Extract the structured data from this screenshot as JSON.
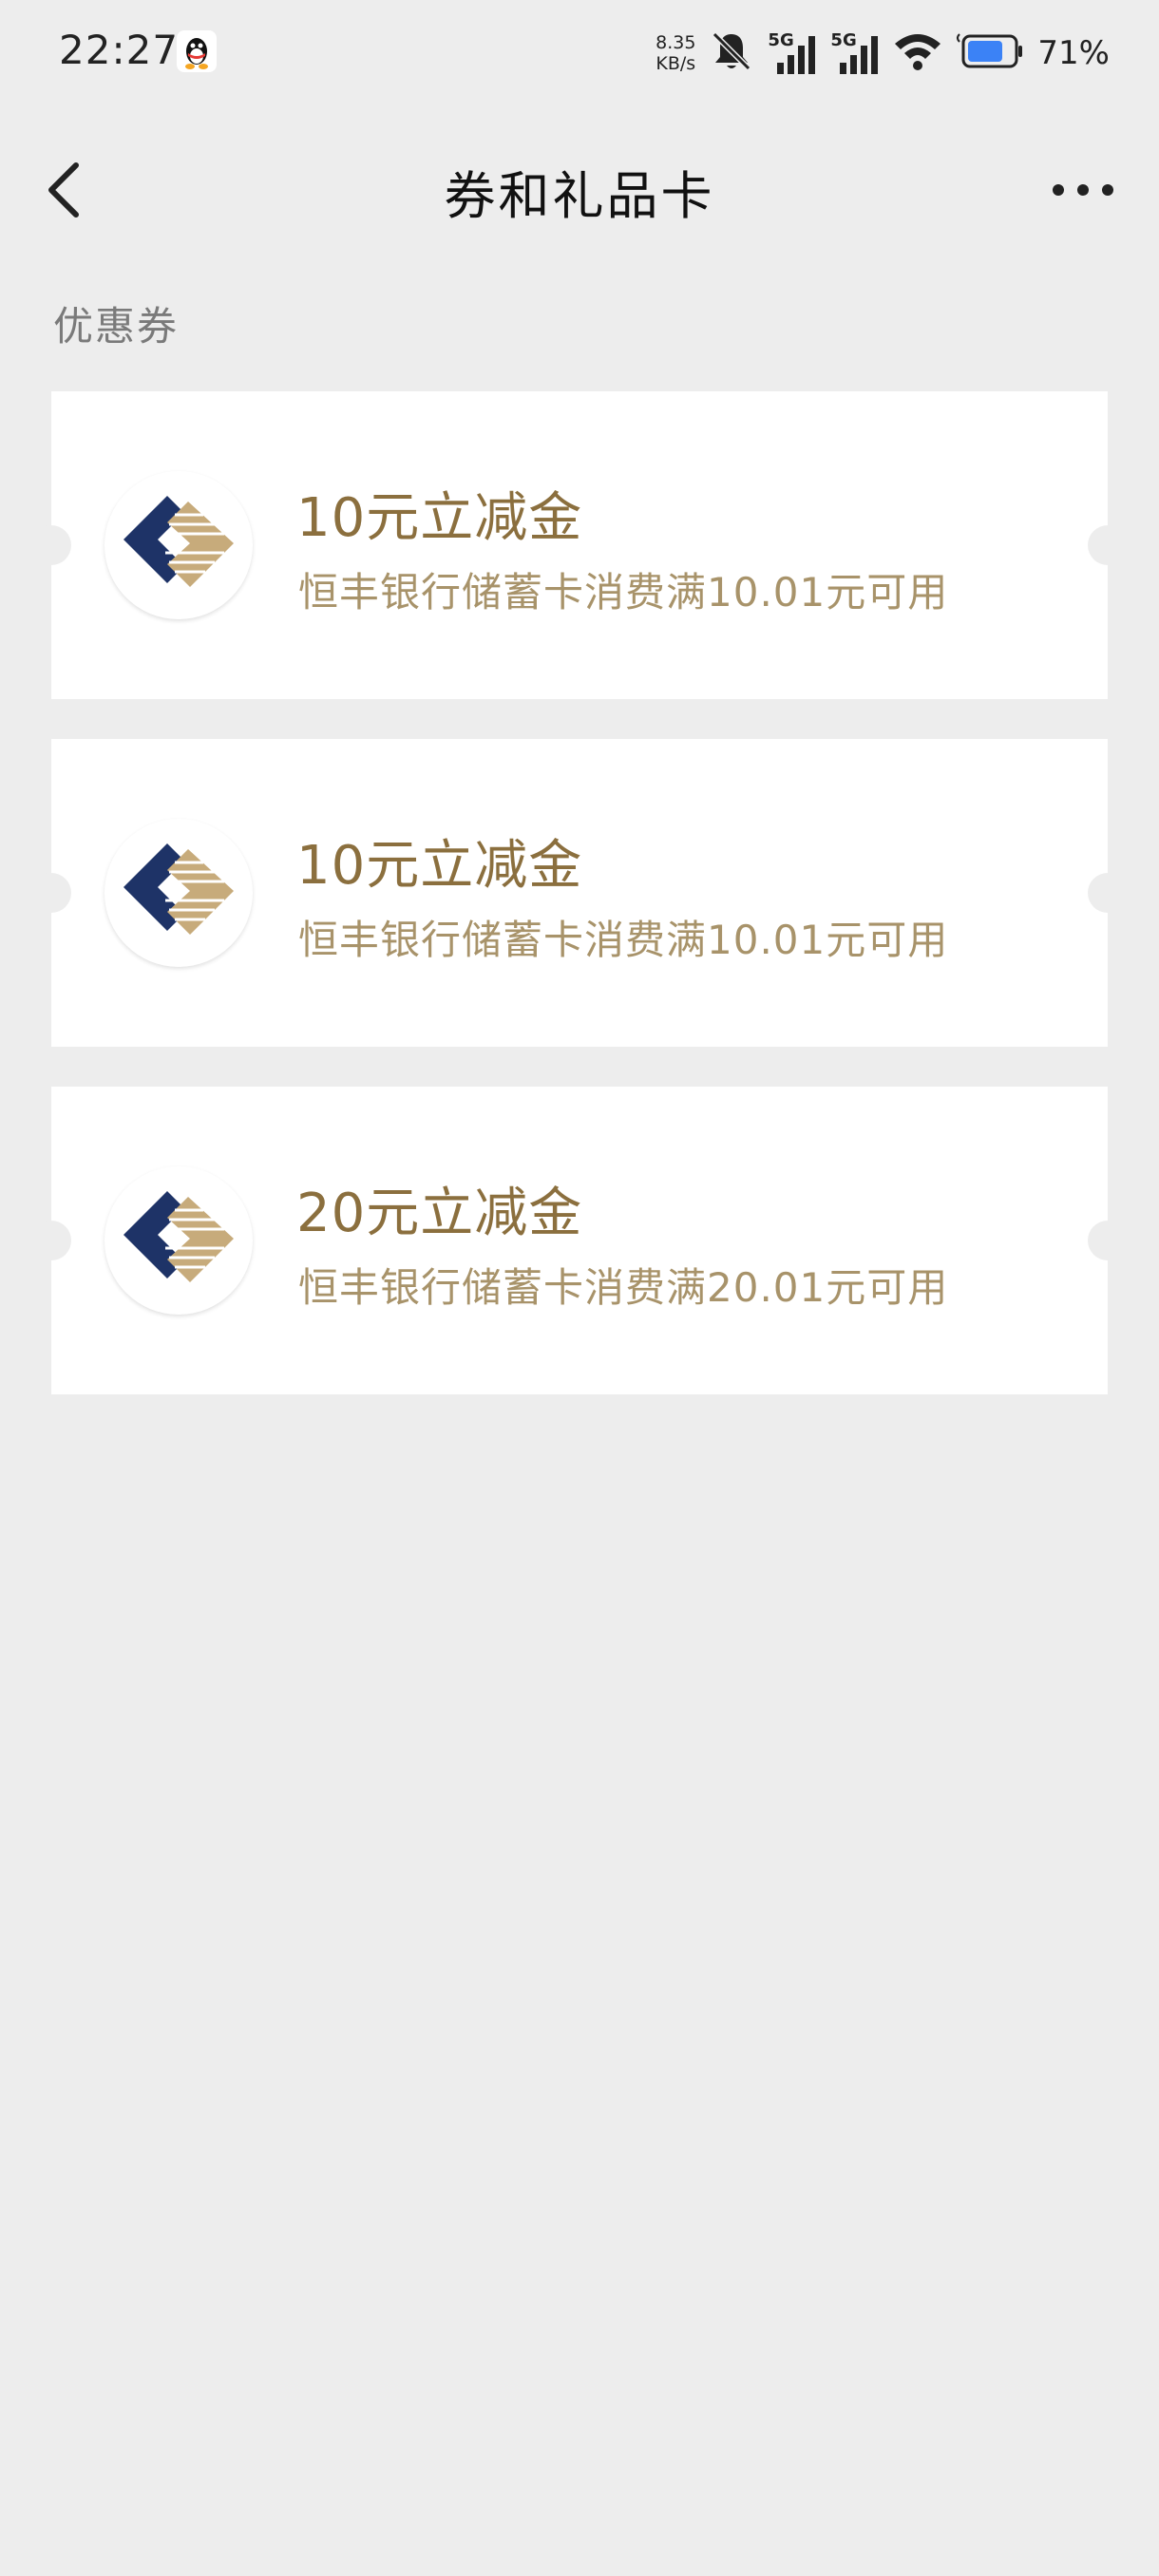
{
  "status_bar": {
    "time": "22:27",
    "net_speed_value": "8.35",
    "net_speed_unit": "KB/s",
    "sim1_label": "5G",
    "sim2_label": "5G",
    "battery_pct": "71%",
    "icons": [
      "qq-icon",
      "mute-icon",
      "signal-icon",
      "wifi-icon",
      "battery-icon"
    ]
  },
  "nav": {
    "title": "券和礼品卡",
    "back_icon": "chevron-left-icon",
    "more_icon": "more-icon"
  },
  "section": {
    "label": "优惠券"
  },
  "coupons": [
    {
      "title": "10元立减金",
      "desc": "恒丰银行储蓄卡消费满10.01元可用"
    },
    {
      "title": "10元立减金",
      "desc": "恒丰银行储蓄卡消费满10.01元可用"
    },
    {
      "title": "20元立减金",
      "desc": "恒丰银行储蓄卡消费满20.01元可用"
    }
  ],
  "colors": {
    "background": "#ededed",
    "card": "#ffffff",
    "coupon_title": "#8b6f3e",
    "coupon_desc": "#a8936a",
    "logo_navy": "#1e3367",
    "logo_gold": "#c7ab7b"
  }
}
